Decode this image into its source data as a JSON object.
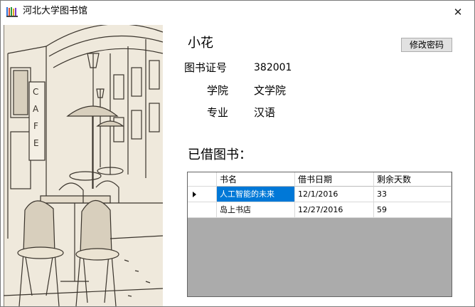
{
  "window": {
    "title": "河北大学图书馆",
    "close_glyph": "✕"
  },
  "profile": {
    "name": "小花",
    "change_password_label": "修改密码",
    "card_label": "图书证号",
    "card_value": "382001",
    "college_label": "学院",
    "college_value": "文学院",
    "major_label": "专业",
    "major_value": "汉语"
  },
  "borrowed": {
    "title": "已借图书：",
    "columns": [
      "书名",
      "借书日期",
      "剩余天数"
    ],
    "rows": [
      {
        "book": "人工智能的未来",
        "date": "12/1/2016",
        "days": "33"
      },
      {
        "book": "岛上书店",
        "date": "12/27/2016",
        "days": "59"
      }
    ]
  },
  "colors": {
    "selection": "#0078d7",
    "grid_background": "#ababab",
    "illustration_bg": "#efe9dc"
  },
  "icons": {
    "app": "books-icon",
    "close": "close-icon",
    "row_indicator": "current-row-arrow-icon"
  }
}
